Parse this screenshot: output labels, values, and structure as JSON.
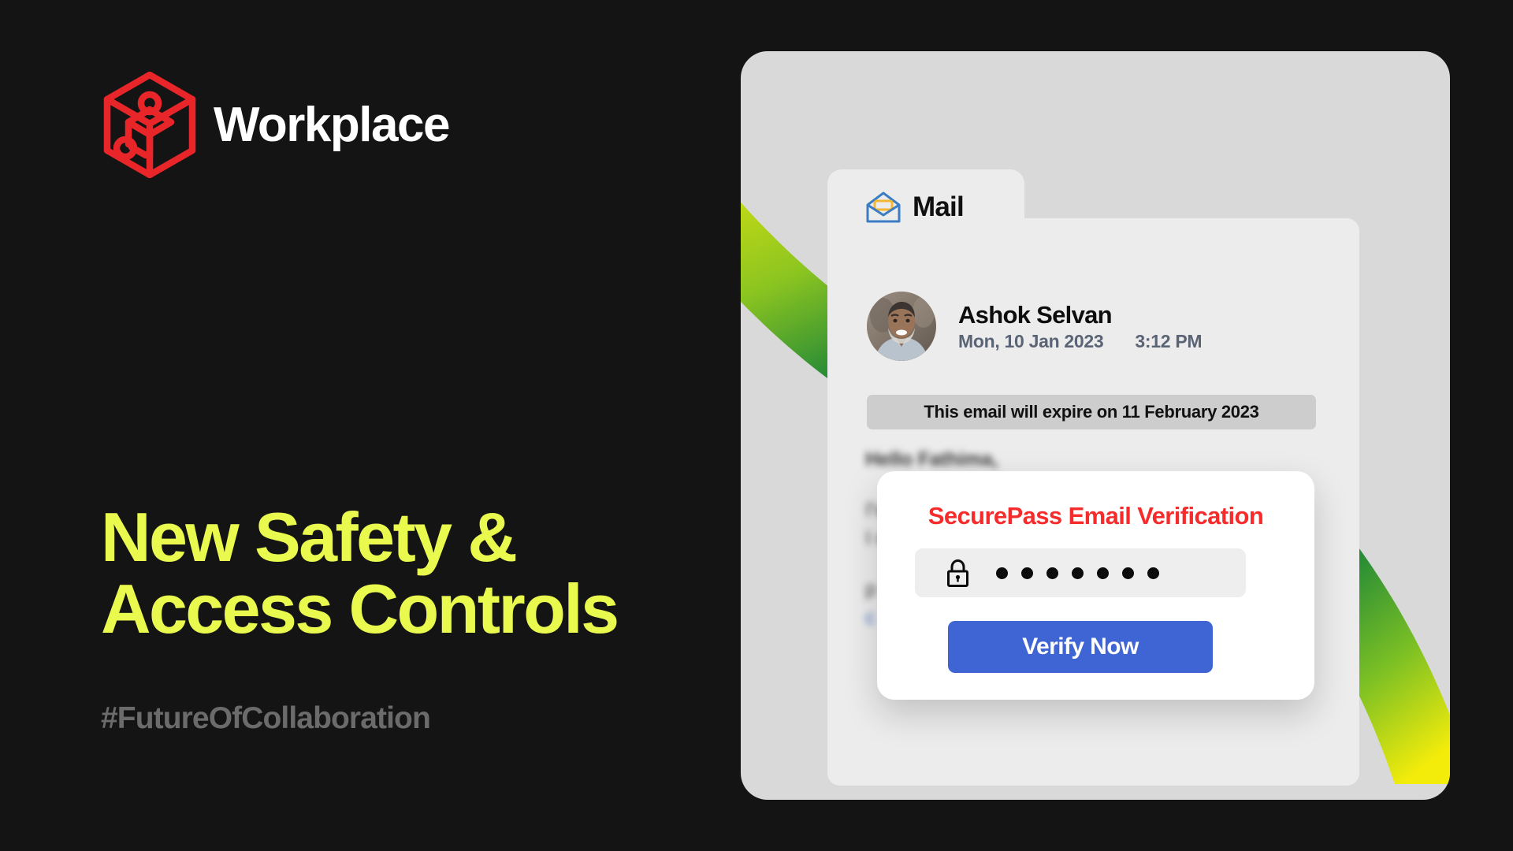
{
  "brand": {
    "name": "Workplace",
    "logo_icon": "workplace-cube-logo",
    "logo_color": "#e8262a"
  },
  "hero": {
    "headline": "New Safety &\nAccess Controls",
    "headline_color": "#e9f94e",
    "hashtag": "#FutureOfCollaboration",
    "hashtag_color": "#6b6b6b"
  },
  "mail_app": {
    "tab": {
      "label": "Mail",
      "icon": "open-envelope-icon",
      "icon_outline_color": "#3b7dc4",
      "icon_letter_color": "#f5b731"
    },
    "message": {
      "avatar": "sender-avatar",
      "sender_name": "Ashok Selvan",
      "date": "Mon,  10 Jan 2023",
      "time": "3:12 PM",
      "expiry_notice": "This email will expire on 11 February 2023",
      "body": {
        "greeting": "Hello Fathima,",
        "lines": [
          "I've been a fan of you and your company for years.",
          "I contacted your support team on Thursday with a"
        ],
        "tail": "p",
        "link_line": "c"
      }
    }
  },
  "securepass_modal": {
    "title": "SecurePass Email Verification",
    "title_color": "#f62b2b",
    "password_icon": "lock-icon",
    "password_masked": "● ● ● ● ● ● ●",
    "password_dot_count": 7,
    "verify_label": "Verify Now",
    "verify_color": "#3f65d4"
  },
  "decoration": {
    "swoosh_green": "#0a7a3c",
    "swoosh_yellow": "#f3ec0b",
    "surface_color": "#d9d9d9",
    "background_color": "#141414"
  }
}
